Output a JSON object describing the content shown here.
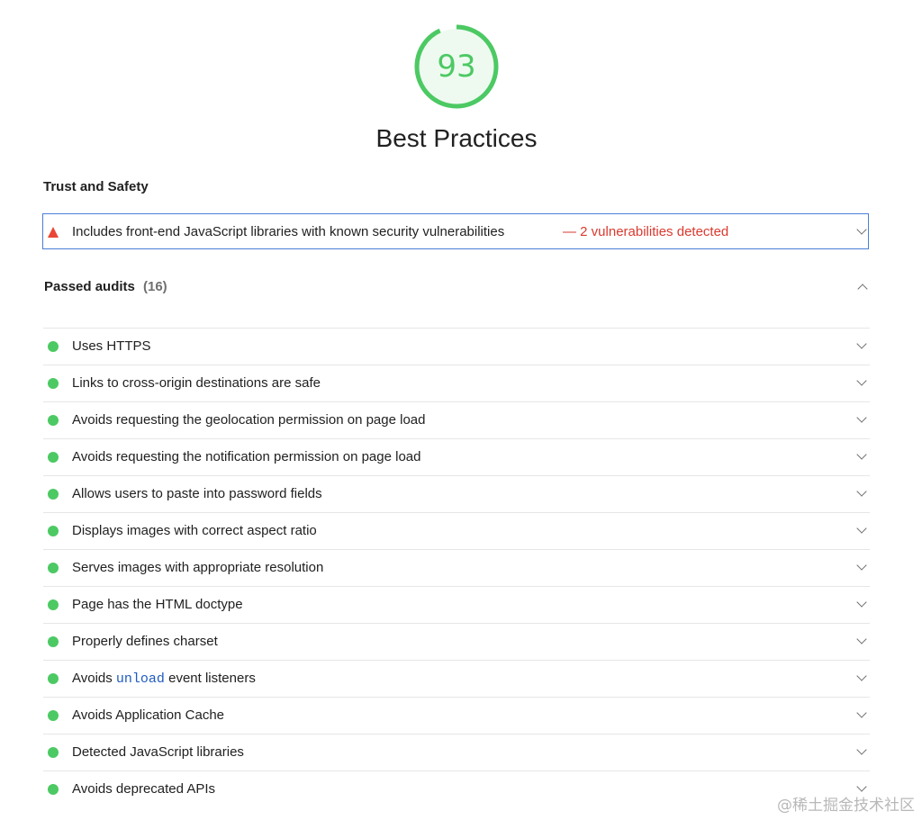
{
  "score": "93",
  "score_fraction": 0.93,
  "category_title": "Best Practices",
  "group_title": "Trust and Safety",
  "failed_audit": {
    "title": "Includes front-end JavaScript libraries with known security vulnerabilities",
    "detail": "— 2 vulnerabilities detected"
  },
  "passed": {
    "label": "Passed audits",
    "count": "(16)"
  },
  "audits": [
    {
      "title": "Uses HTTPS"
    },
    {
      "title": "Links to cross-origin destinations are safe"
    },
    {
      "title": "Avoids requesting the geolocation permission on page load"
    },
    {
      "title": "Avoids requesting the notification permission on page load"
    },
    {
      "title": "Allows users to paste into password fields"
    },
    {
      "title": "Displays images with correct aspect ratio"
    },
    {
      "title": "Serves images with appropriate resolution"
    },
    {
      "title": "Page has the HTML doctype"
    },
    {
      "title": "Properly defines charset"
    },
    {
      "before": "Avoids ",
      "code": "unload",
      "after": " event listeners"
    },
    {
      "title": "Avoids Application Cache"
    },
    {
      "title": "Detected JavaScript libraries"
    },
    {
      "title": "Avoids deprecated APIs"
    }
  ],
  "watermark": "@稀土掘金技术社区",
  "colors": {
    "pass": "#4cc963",
    "fail": "#eb4536",
    "focus_border": "#4a7fd8"
  }
}
